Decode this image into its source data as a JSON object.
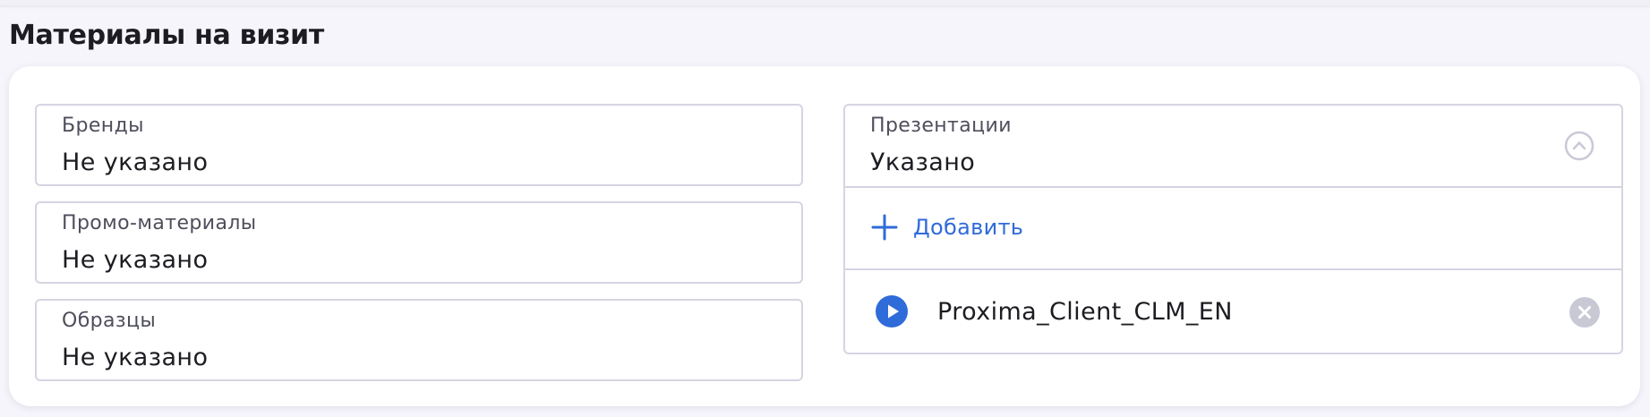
{
  "section": {
    "title": "Материалы на визит"
  },
  "fields": [
    {
      "label": "Бренды",
      "value": "Не указано"
    },
    {
      "label": "Промо-материалы",
      "value": "Не указано"
    },
    {
      "label": "Образцы",
      "value": "Не указано"
    }
  ],
  "presentations": {
    "label": "Презентации",
    "value": "Указано",
    "add_label": "Добавить",
    "items": [
      {
        "name": "Proxima_Client_CLM_EN"
      }
    ]
  },
  "colors": {
    "accent": "#2f6bd9",
    "border": "#d5d5e2",
    "muted_icon": "#c9c9d6"
  },
  "icons": {
    "collapse": "chevron-up-circle-icon",
    "add": "plus-icon",
    "play": "play-circle-icon",
    "remove": "close-circle-icon"
  }
}
